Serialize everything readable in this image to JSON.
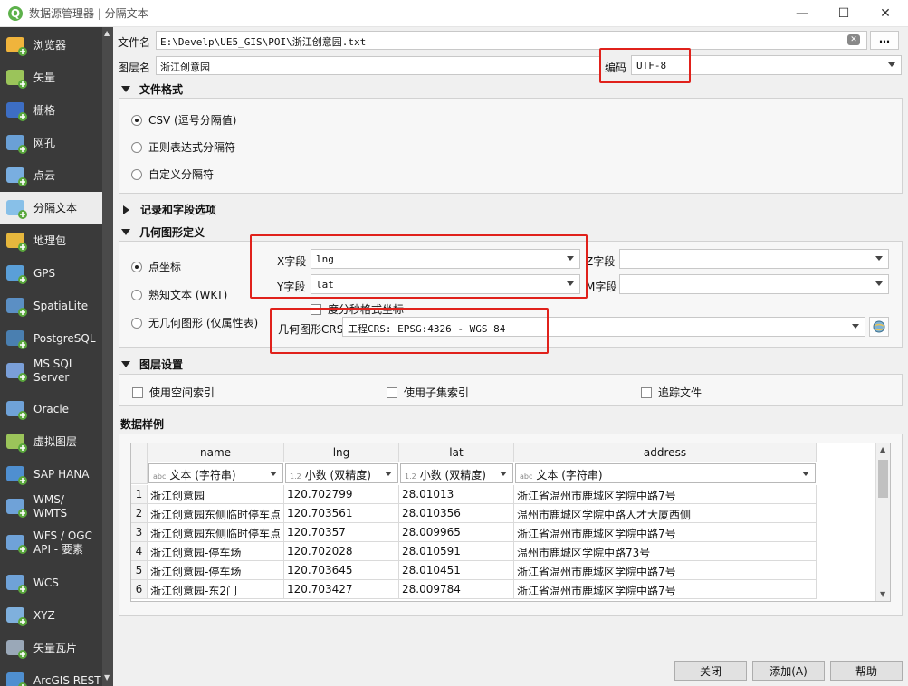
{
  "window": {
    "title": "数据源管理器 | 分隔文本",
    "app_icon": "Q",
    "minimize": "—",
    "maximize": "☐",
    "close": "✕"
  },
  "sidebar": {
    "items": [
      {
        "label": "浏览器",
        "icon": "folder-icon"
      },
      {
        "label": "矢量",
        "icon": "vector-icon"
      },
      {
        "label": "栅格",
        "icon": "raster-icon"
      },
      {
        "label": "网孔",
        "icon": "mesh-icon"
      },
      {
        "label": "点云",
        "icon": "point-cloud-icon"
      },
      {
        "label": "分隔文本",
        "icon": "delimited-text-icon"
      },
      {
        "label": "地理包",
        "icon": "geopackage-icon"
      },
      {
        "label": "GPS",
        "icon": "gps-icon"
      },
      {
        "label": "SpatiaLite",
        "icon": "spatialite-icon"
      },
      {
        "label": "PostgreSQL",
        "icon": "postgresql-icon"
      },
      {
        "label": "MS SQL\nServer",
        "icon": "mssql-icon"
      },
      {
        "label": "Oracle",
        "icon": "oracle-icon"
      },
      {
        "label": "虚拟图层",
        "icon": "virtual-layer-icon"
      },
      {
        "label": "SAP HANA",
        "icon": "sap-hana-icon"
      },
      {
        "label": "WMS/\nWMTS",
        "icon": "wms-icon"
      },
      {
        "label": "WFS / OGC\nAPI - 要素",
        "icon": "wfs-icon"
      },
      {
        "label": "WCS",
        "icon": "wcs-icon"
      },
      {
        "label": "XYZ",
        "icon": "xyz-icon"
      },
      {
        "label": "矢量瓦片",
        "icon": "vector-tile-icon"
      },
      {
        "label": "ArcGIS REST",
        "icon": "arcgis-icon"
      }
    ],
    "selected": "分隔文本"
  },
  "file": {
    "label": "文件名",
    "value": "E:\\Develp\\UE5_GIS\\POI\\浙江创意园.txt",
    "more": "…"
  },
  "layer": {
    "label": "图层名",
    "value": "浙江创意园",
    "encoding_label": "编码",
    "encoding_value": "UTF-8"
  },
  "file_format": {
    "header": "文件格式",
    "options": [
      "CSV (逗号分隔值)",
      "正则表达式分隔符",
      "自定义分隔符"
    ],
    "selected": 0
  },
  "records": {
    "header": "记录和字段选项"
  },
  "geometry": {
    "header": "几何图形定义",
    "options": [
      "点坐标",
      "熟知文本 (WKT)",
      "无几何图形 (仅属性表)"
    ],
    "selected": 0,
    "x_label": "X字段",
    "x_value": "lng",
    "y_label": "Y字段",
    "y_value": "lat",
    "z_label": "Z字段",
    "z_value": "",
    "m_label": "M字段",
    "m_value": "",
    "dms_label": "度分秒格式坐标",
    "crs_label": "几何图形CRS",
    "crs_value": "工程CRS: EPSG:4326 - WGS 84"
  },
  "layer_settings": {
    "header": "图层设置",
    "spatial_index": "使用空间索引",
    "subset_index": "使用子集索引",
    "watch_file": "追踪文件"
  },
  "sample": {
    "header": "数据样例",
    "columns": [
      "name",
      "lng",
      "lat",
      "address"
    ],
    "types": [
      {
        "prefix": "abc",
        "label": "文本 (字符串)"
      },
      {
        "prefix": "1.2",
        "label": "小数 (双精度)"
      },
      {
        "prefix": "1.2",
        "label": "小数 (双精度)"
      },
      {
        "prefix": "abc",
        "label": "文本 (字符串)"
      }
    ],
    "rows": [
      [
        "1",
        "浙江创意园",
        "120.702799",
        "28.01013",
        "浙江省温州市鹿城区学院中路7号"
      ],
      [
        "2",
        "浙江创意园东侧临时停车点",
        "120.703561",
        "28.010356",
        "温州市鹿城区学院中路人才大厦西侧"
      ],
      [
        "3",
        "浙江创意园东侧临时停车点",
        "120.70357",
        "28.009965",
        "浙江省温州市鹿城区学院中路7号"
      ],
      [
        "4",
        "浙江创意园-停车场",
        "120.702028",
        "28.010591",
        "温州市鹿城区学院中路73号"
      ],
      [
        "5",
        "浙江创意园-停车场",
        "120.703645",
        "28.010451",
        "浙江省温州市鹿城区学院中路7号"
      ],
      [
        "6",
        "浙江创意园-东2门",
        "120.703427",
        "28.009784",
        "浙江省温州市鹿城区学院中路7号"
      ]
    ]
  },
  "buttons": {
    "close": "关闭",
    "add": "添加(A)",
    "help": "帮助"
  }
}
